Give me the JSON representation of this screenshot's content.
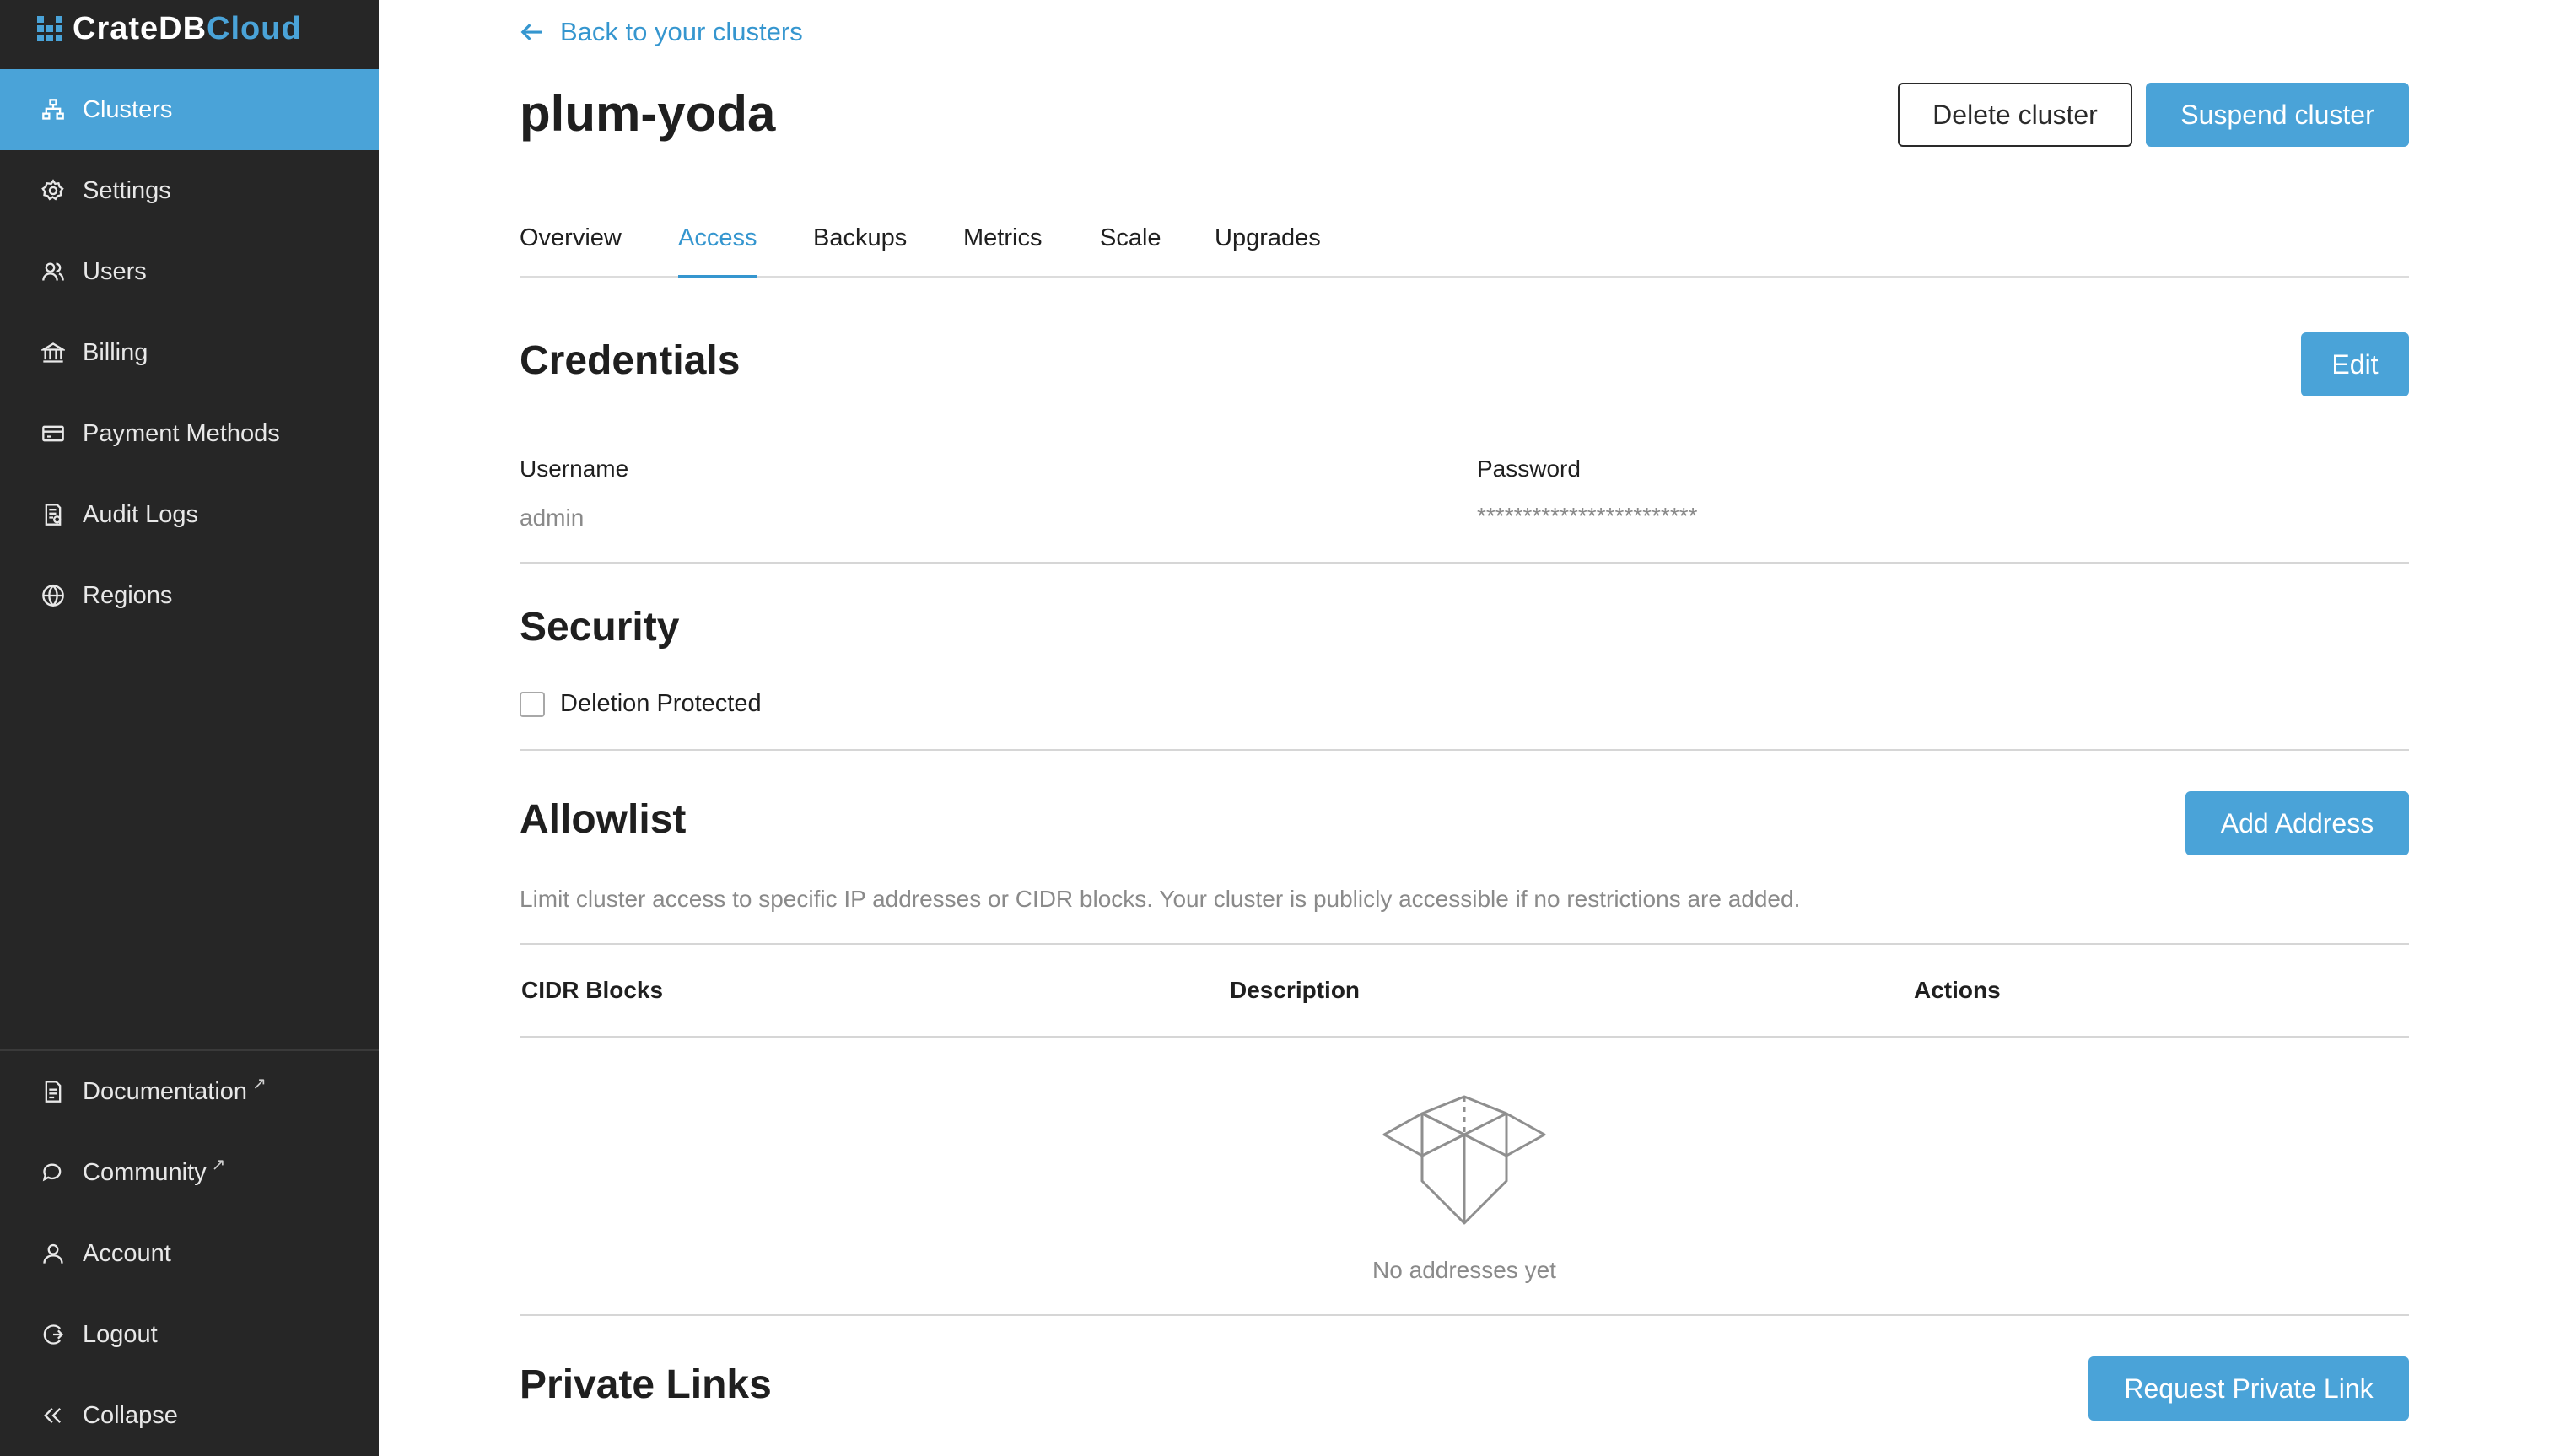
{
  "brand": {
    "part1": "CrateDB",
    "part2": "Cloud",
    "accent": "#4aa3d8"
  },
  "sidebar": {
    "items": [
      {
        "label": "Clusters",
        "icon": "clusters-icon",
        "active": true
      },
      {
        "label": "Settings",
        "icon": "gear-icon"
      },
      {
        "label": "Users",
        "icon": "users-icon"
      },
      {
        "label": "Billing",
        "icon": "bank-icon"
      },
      {
        "label": "Payment Methods",
        "icon": "credit-card-icon"
      },
      {
        "label": "Audit Logs",
        "icon": "audit-log-icon"
      },
      {
        "label": "Regions",
        "icon": "globe-icon"
      }
    ],
    "bottom_items": [
      {
        "label": "Documentation",
        "icon": "document-icon",
        "external": true
      },
      {
        "label": "Community",
        "icon": "chat-icon",
        "external": true
      },
      {
        "label": "Account",
        "icon": "user-icon"
      },
      {
        "label": "Logout",
        "icon": "logout-icon"
      },
      {
        "label": "Collapse",
        "icon": "double-chevron-left-icon"
      }
    ],
    "external_glyph": "↗"
  },
  "header": {
    "back_link": "Back to your clusters",
    "title": "plum-yoda",
    "delete_button": "Delete cluster",
    "suspend_button": "Suspend cluster"
  },
  "tabs": [
    {
      "label": "Overview"
    },
    {
      "label": "Access",
      "active": true
    },
    {
      "label": "Backups"
    },
    {
      "label": "Metrics"
    },
    {
      "label": "Scale"
    },
    {
      "label": "Upgrades"
    }
  ],
  "credentials": {
    "title": "Credentials",
    "edit_button": "Edit",
    "username_label": "Username",
    "username_value": "admin",
    "password_label": "Password",
    "password_value": "************************"
  },
  "security": {
    "title": "Security",
    "deletion_protected_label": "Deletion Protected",
    "deletion_protected_checked": false
  },
  "allowlist": {
    "title": "Allowlist",
    "add_button": "Add Address",
    "description": "Limit cluster access to specific IP addresses or CIDR blocks. Your cluster is publicly accessible if no restrictions are added.",
    "columns": [
      "CIDR Blocks",
      "Description",
      "Actions"
    ],
    "empty_text": "No addresses yet"
  },
  "private_links": {
    "title": "Private Links",
    "request_button": "Request Private Link"
  }
}
